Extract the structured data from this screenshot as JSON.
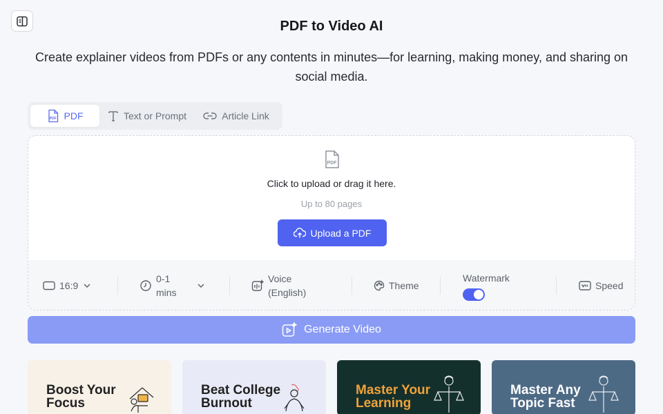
{
  "header": {
    "title": "PDF to Video AI",
    "subtitle": "Create explainer videos from PDFs or any contents in minutes—for learning, making money, and sharing on social media."
  },
  "tabs": [
    {
      "label": "PDF",
      "icon": "pdf-file-icon",
      "active": true
    },
    {
      "label": "Text or Prompt",
      "icon": "text-icon",
      "active": false
    },
    {
      "label": "Article Link",
      "icon": "link-icon",
      "active": false
    }
  ],
  "upload": {
    "instruction": "Click to upload or drag it here.",
    "limit": "Up to 80 pages",
    "button_label": "Upload a PDF"
  },
  "options": {
    "aspect_ratio": "16:9",
    "duration_line1": "0-1",
    "duration_line2": "mins",
    "voice_line1": "Voice",
    "voice_line2": "(English)",
    "theme": "Theme",
    "watermark": "Watermark",
    "watermark_on": true,
    "speed": "Speed"
  },
  "generate": {
    "label": "Generate Video"
  },
  "cards": [
    {
      "title_line1": "Boost Your",
      "title_line2": "Focus",
      "bg": "#f7f1e8",
      "color": "#222222"
    },
    {
      "title_line1": "Beat College",
      "title_line2": "Burnout",
      "bg": "#e9eaf7",
      "color": "#222222"
    },
    {
      "title_line1": "Master Your",
      "title_line2": "Learning",
      "bg": "#14302c",
      "color": "#f0a23a"
    },
    {
      "title_line1": "Master Any",
      "title_line2": "Topic Fast",
      "bg": "#4d6a85",
      "color": "#ffffff"
    }
  ],
  "colors": {
    "accent": "#4f63f0",
    "accent_light": "#8a9bf5"
  }
}
